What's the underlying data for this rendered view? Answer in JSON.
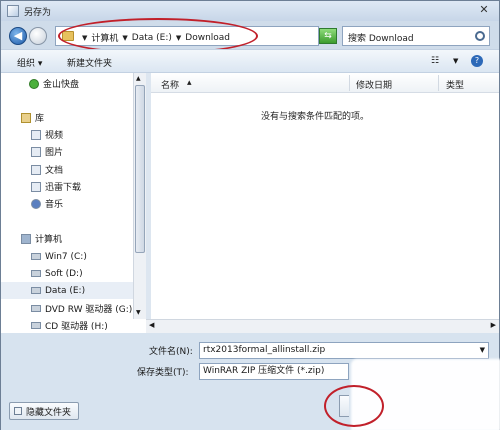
{
  "window": {
    "title": "另存为",
    "close_glyph": "✕"
  },
  "address": {
    "crumbs": [
      "计算机",
      "Data (E:)",
      "Download"
    ],
    "search_placeholder": "搜索 Download"
  },
  "toolbar": {
    "organize": "组织 ▾",
    "new_folder": "新建文件夹",
    "view_glyph": "☷",
    "help_glyph": "?"
  },
  "nav": {
    "items": [
      {
        "label": "金山快盘",
        "icon": "cloud-icon"
      },
      {
        "label": "库",
        "icon": "library-icon"
      },
      {
        "label": "视频",
        "icon": "video-icon"
      },
      {
        "label": "图片",
        "icon": "picture-icon"
      },
      {
        "label": "文档",
        "icon": "document-icon"
      },
      {
        "label": "迅雷下载",
        "icon": "download-icon"
      },
      {
        "label": "音乐",
        "icon": "music-icon"
      },
      {
        "label": "计算机",
        "icon": "computer-icon"
      },
      {
        "label": "Win7 (C:)",
        "icon": "drive-icon"
      },
      {
        "label": "Soft (D:)",
        "icon": "drive-icon"
      },
      {
        "label": "Data (E:)",
        "icon": "drive-icon",
        "selected": true
      },
      {
        "label": "DVD RW 驱动器 (G:)",
        "icon": "dvd-icon"
      },
      {
        "label": "CD 驱动器 (H:)",
        "icon": "cd-icon"
      }
    ]
  },
  "files": {
    "columns": [
      "名称",
      "修改日期",
      "类型"
    ],
    "empty_message": "没有与搜索条件匹配的项。"
  },
  "form": {
    "filename_label": "文件名(N):",
    "filename_value": "rtx2013formal_allinstall.zip",
    "filetype_label": "保存类型(T):",
    "filetype_value": "WinRAR ZIP 压缩文件 (*.zip)",
    "hide_folders": "隐藏文件夹"
  },
  "colors": {
    "annotation": "#c1202a",
    "accent": "#1d5aa8"
  }
}
